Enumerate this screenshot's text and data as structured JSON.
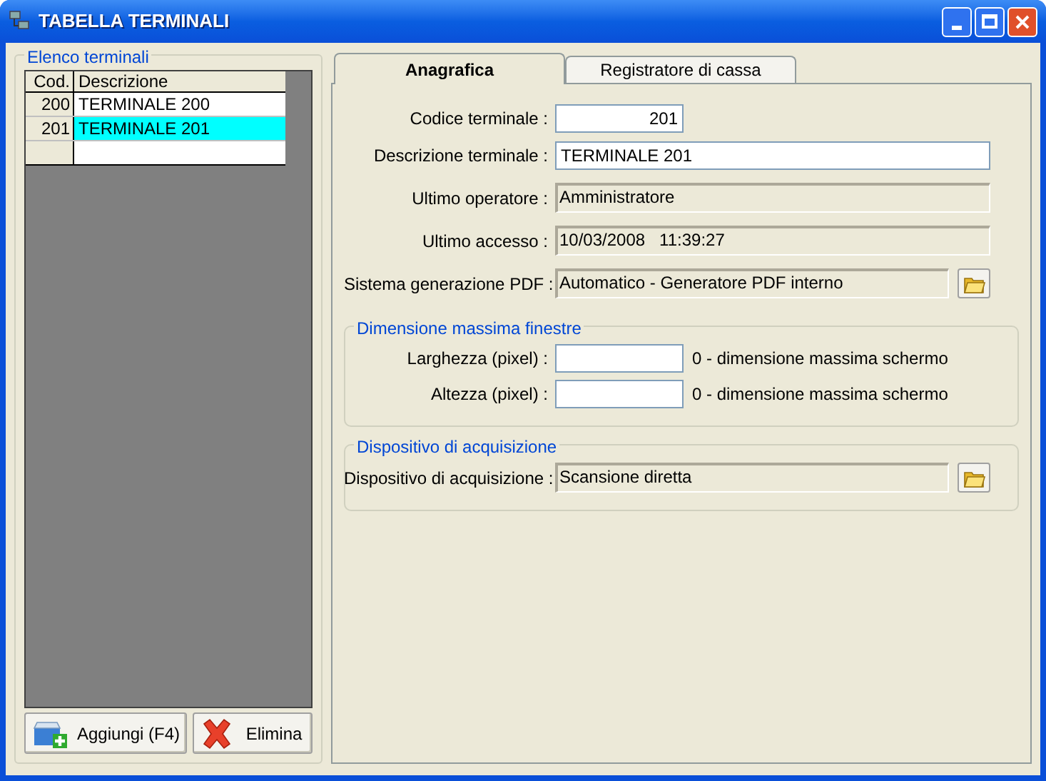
{
  "window": {
    "title": "TABELLA TERMINALI"
  },
  "list_group": {
    "title": "Elenco terminali"
  },
  "table": {
    "columns": [
      "Cod.",
      "Descrizione"
    ],
    "rows": [
      {
        "cod": "200",
        "descrizione": "TERMINALE 200",
        "selected": false
      },
      {
        "cod": "201",
        "descrizione": "TERMINALE 201",
        "selected": true
      }
    ]
  },
  "buttons": [
    {
      "label": "Aggiungi (F4)",
      "kind": "add"
    },
    {
      "label": "Elimina",
      "kind": "delete"
    }
  ],
  "tabs": [
    {
      "label": "Anagrafica",
      "selected": true
    },
    {
      "label": "Registratore di cassa",
      "selected": false
    }
  ],
  "fields": [
    {
      "label": "Codice terminale :",
      "value": "201",
      "kind": "code"
    },
    {
      "label": "Descrizione terminale :",
      "value": "TERMINALE 201",
      "kind": "input"
    },
    {
      "label": "Ultimo operatore :",
      "value": "Amministratore",
      "kind": "readonly"
    },
    {
      "label": "Ultimo accesso :",
      "value": "10/03/2008   11:39:27",
      "kind": "readonly"
    },
    {
      "label": "Sistema generazione PDF :",
      "value": "Automatico - Generatore PDF interno",
      "kind": "browse"
    }
  ],
  "groups": [
    {
      "title": "Dimensione massima finestre",
      "fields": [
        {
          "label": "Larghezza (pixel) :",
          "kind": "size",
          "hint": "0 - dimensione massima schermo"
        },
        {
          "label": "Altezza (pixel) :",
          "kind": "size",
          "hint": "0 - dimensione massima schermo"
        }
      ]
    },
    {
      "title": "Dispositivo di acquisizione",
      "fields": [
        {
          "label": "Dispositivo di acquisizione :",
          "value": "Scansione diretta",
          "kind": "browse"
        }
      ]
    }
  ]
}
